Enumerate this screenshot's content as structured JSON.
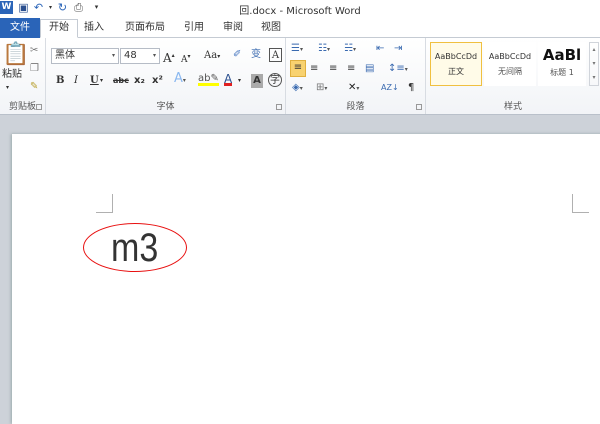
{
  "window": {
    "title": "回.docx - Microsoft Word"
  },
  "quick_access": {
    "icons": [
      "word-icon",
      "save-icon",
      "undo-icon",
      "redo-icon",
      "print-preview-icon",
      "customize-icon"
    ]
  },
  "tabs": [
    {
      "label": "文件"
    },
    {
      "label": "开始"
    },
    {
      "label": "插入"
    },
    {
      "label": "页面布局"
    },
    {
      "label": "引用"
    },
    {
      "label": "审阅"
    },
    {
      "label": "视图"
    }
  ],
  "ribbon": {
    "clipboard": {
      "label": "剪贴板",
      "paste": "粘贴"
    },
    "font": {
      "label": "字体",
      "font_name": "黑体",
      "font_size": "48",
      "change_case": "Aa",
      "bold": "B",
      "italic": "I",
      "underline": "U",
      "strikethrough": "abc",
      "subscript": "x₂",
      "superscript": "x²",
      "font_color": "#e02020",
      "highlight_color": "#ffff00"
    },
    "paragraph": {
      "label": "段落"
    },
    "styles": {
      "label": "样式",
      "items": [
        {
          "preview": "AaBbCcDd",
          "name": "正文",
          "selected": true
        },
        {
          "preview": "AaBbCcDd",
          "name": "无间隔"
        },
        {
          "preview": "AaBl",
          "name": "标题 1"
        }
      ]
    }
  },
  "document": {
    "text": "m3",
    "annotation_color": "#e81010"
  }
}
